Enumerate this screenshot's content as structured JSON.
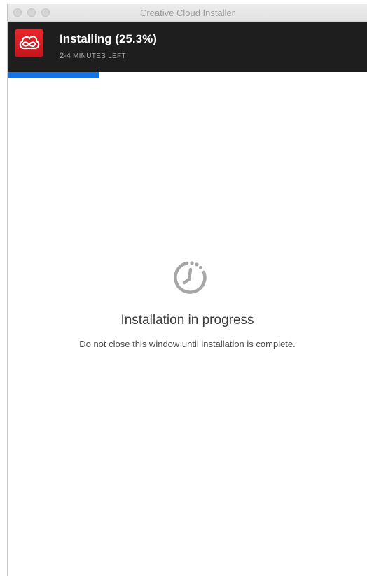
{
  "window": {
    "title": "Creative Cloud Installer"
  },
  "header": {
    "status_title": "Installing (25.3%)",
    "time_prefix": "2-4",
    "time_suffix": "MINUTES LEFT",
    "logo_icon": "adobe-creative-cloud-logo"
  },
  "progress": {
    "percent": 25.3,
    "color": "#1473e6"
  },
  "main": {
    "icon": "clock-progress-icon",
    "message": "Installation in progress",
    "sub_message": "Do not close this window until installation is complete."
  },
  "colors": {
    "header_bg": "#1e1e1e",
    "logo_red": "#da1f26",
    "accent_blue": "#1473e6"
  }
}
